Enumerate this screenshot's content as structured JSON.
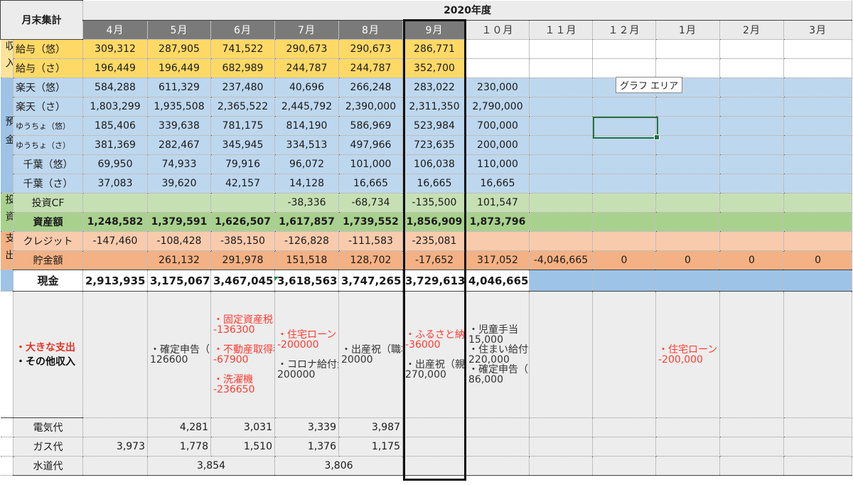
{
  "corner": "月末集計",
  "fiscal_year": "2020年度",
  "months": [
    "4月",
    "5月",
    "6月",
    "7月",
    "8月",
    "9月",
    "１０月",
    "１１月",
    "１２月",
    "1月",
    "2月",
    "3月"
  ],
  "categories": {
    "income": "収入",
    "deposit": "預金",
    "invest": "投資",
    "expense": "支出"
  },
  "rows": {
    "salary_yu": {
      "label": "給与（悠）",
      "values": [
        "309,312",
        "287,905",
        "741,522",
        "290,673",
        "290,673",
        "286,771",
        "",
        "",
        "",
        "",
        "",
        ""
      ]
    },
    "salary_sa": {
      "label": "給与（さ）",
      "values": [
        "196,449",
        "196,449",
        "682,989",
        "244,787",
        "244,787",
        "352,700",
        "",
        "",
        "",
        "",
        "",
        ""
      ]
    },
    "rakuten_yu": {
      "label": "楽天（悠）",
      "values": [
        "584,288",
        "611,329",
        "237,480",
        "40,696",
        "266,248",
        "283,022",
        "230,000",
        "",
        "",
        "",
        "",
        ""
      ]
    },
    "rakuten_sa": {
      "label": "楽天（さ）",
      "values": [
        "1,803,299",
        "1,935,508",
        "2,365,522",
        "2,445,792",
        "2,390,000",
        "2,311,350",
        "2,790,000",
        "",
        "",
        "",
        "",
        ""
      ]
    },
    "yucho_yu": {
      "label": "ゆうちょ（悠）",
      "values": [
        "185,406",
        "339,638",
        "781,175",
        "814,190",
        "586,969",
        "523,984",
        "700,000",
        "",
        "",
        "",
        "",
        ""
      ]
    },
    "yucho_sa": {
      "label": "ゆうちょ（さ）",
      "values": [
        "381,369",
        "282,467",
        "345,945",
        "334,513",
        "497,966",
        "723,635",
        "200,000",
        "",
        "",
        "",
        "",
        ""
      ]
    },
    "chiba_yu": {
      "label": "千葉（悠）",
      "values": [
        "69,950",
        "74,933",
        "79,916",
        "96,072",
        "101,000",
        "106,038",
        "110,000",
        "",
        "",
        "",
        "",
        ""
      ]
    },
    "chiba_sa": {
      "label": "千葉（さ）",
      "values": [
        "37,083",
        "39,620",
        "42,157",
        "14,128",
        "16,665",
        "16,665",
        "16,665",
        "",
        "",
        "",
        "",
        ""
      ]
    },
    "invest_cf": {
      "label": "投資CF",
      "values": [
        "",
        "",
        "",
        "-38,336",
        "-68,734",
        "-135,500",
        "101,547",
        "",
        "",
        "",
        "",
        ""
      ]
    },
    "assets": {
      "label": "資産額",
      "values": [
        "1,248,582",
        "1,379,591",
        "1,626,507",
        "1,617,857",
        "1,739,552",
        "1,856,909",
        "1,873,796",
        "",
        "",
        "",
        "",
        ""
      ]
    },
    "credit": {
      "label": "クレジット",
      "values": [
        "-147,460",
        "-108,428",
        "-385,150",
        "-126,828",
        "-111,583",
        "-235,081",
        "",
        "",
        "",
        "",
        "",
        ""
      ]
    },
    "savings": {
      "label": "貯金額",
      "values": [
        "",
        "261,132",
        "291,978",
        "151,518",
        "128,702",
        "-17,652",
        "317,052",
        "-4,046,665",
        "0",
        "0",
        "0",
        "0"
      ]
    },
    "cash": {
      "label": "現金",
      "values": [
        "2,913,935",
        "3,175,067",
        "3,467,045",
        "3,618,563",
        "3,747,265",
        "3,729,613",
        "4,046,665",
        "",
        "",
        "",
        "",
        ""
      ]
    }
  },
  "notes_label": {
    "big_expense": "・大きな支出",
    "other_income": "・その他収入"
  },
  "notes": {
    "m5": [
      {
        "t": "・確定申告（ゆ）",
        "c": "blk"
      },
      {
        "t": "126600",
        "c": "blk"
      }
    ],
    "m6": [
      {
        "t": "・固定資産税",
        "c": "red"
      },
      {
        "t": "-136300",
        "c": "red"
      },
      {
        "t": "",
        "c": "red"
      },
      {
        "t": "・不動産取得税",
        "c": "red"
      },
      {
        "t": "-67900",
        "c": "red"
      },
      {
        "t": "",
        "c": "red"
      },
      {
        "t": "・洗濯機",
        "c": "red"
      },
      {
        "t": "-236650",
        "c": "red"
      }
    ],
    "m7": [
      {
        "t": "・住宅ローン（ボーナス）",
        "c": "red"
      },
      {
        "t": "-200000",
        "c": "red"
      },
      {
        "t": "",
        "c": "blk"
      },
      {
        "t": "・コロナ給付金",
        "c": "blk"
      },
      {
        "t": "200000",
        "c": "blk"
      }
    ],
    "m8": [
      {
        "t": "・出産祝（職場）",
        "c": "blk"
      },
      {
        "t": "20000",
        "c": "blk"
      }
    ],
    "m9": [
      {
        "t": "・ふるさと納税",
        "c": "red"
      },
      {
        "t": "-36000",
        "c": "red"
      },
      {
        "t": "",
        "c": "blk"
      },
      {
        "t": "・出産祝（親族）",
        "c": "blk"
      },
      {
        "t": "270,000",
        "c": "blk"
      }
    ],
    "m10": [
      {
        "t": "・児童手当",
        "c": "blk"
      },
      {
        "t": "15,000",
        "c": "blk"
      },
      {
        "t": "・住まい給付金",
        "c": "blk"
      },
      {
        "t": "220,000",
        "c": "blk"
      },
      {
        "t": "・確定申告（さ）",
        "c": "blk"
      },
      {
        "t": "86,000",
        "c": "blk"
      }
    ],
    "m1": [
      {
        "t": "・住宅ローン（ボーナス）",
        "c": "red"
      },
      {
        "t": "-200,000",
        "c": "red"
      }
    ]
  },
  "utilities": {
    "electric": {
      "label": "電気代",
      "values": [
        "",
        "4,281",
        "3,031",
        "3,339",
        "3,987"
      ]
    },
    "gas": {
      "label": "ガス代",
      "values": [
        "3,973",
        "1,778",
        "1,510",
        "1,376",
        "1,175"
      ]
    },
    "water": {
      "label": "水道代",
      "v1": "3,854",
      "v2": "3,806"
    }
  },
  "chart_area_tip": "グラフ エリア",
  "colors": {
    "income": "#ffd966",
    "deposit": "#bdd7ee",
    "invest": "#c6e0b4",
    "expense": "#f8cbad",
    "negative": "#ff3b30",
    "header_dark": "#7a7a7a"
  }
}
